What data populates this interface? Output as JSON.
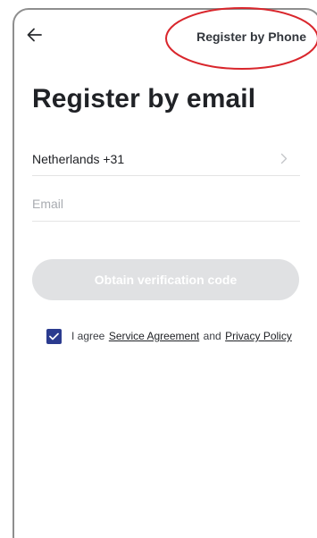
{
  "header": {
    "back_icon": "arrow-left-icon",
    "register_by_phone_label": "Register by Phone",
    "annotation_color": "#d9262c"
  },
  "title": "Register by email",
  "form": {
    "country_label": "Netherlands +31",
    "country_chevron_icon": "chevron-right-icon",
    "email_value": "",
    "email_placeholder": "Email",
    "obtain_button_label": "Obtain verification code"
  },
  "agreement": {
    "checked": true,
    "prefix": "I agree",
    "service_link": "Service Agreement",
    "conjunction": "and",
    "privacy_link": "Privacy Policy",
    "checkbox_color": "#2b3b8f"
  },
  "colors": {
    "button_disabled_bg": "#e0e1e3",
    "text_primary": "#202226",
    "divider": "#e4e4e4"
  }
}
